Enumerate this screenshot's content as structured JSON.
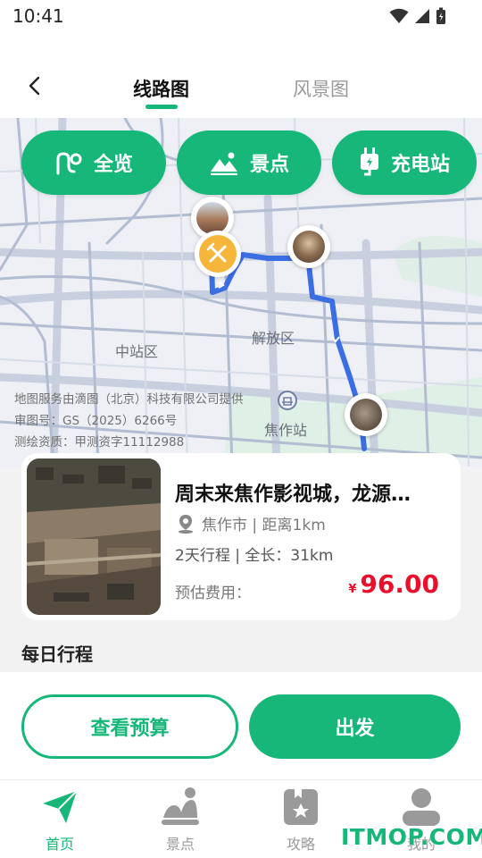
{
  "status_bar": {
    "time": "10:41",
    "tiny_code": "294a0701"
  },
  "header": {
    "tabs": [
      {
        "label": "线路图",
        "active": true
      },
      {
        "label": "风景图",
        "active": false
      }
    ]
  },
  "map": {
    "chips": [
      {
        "label": "全览",
        "icon": "route-icon"
      },
      {
        "label": "景点",
        "icon": "landscape-icon"
      },
      {
        "label": "充电站",
        "icon": "charging-plug-icon"
      }
    ],
    "labels": {
      "district_1": "中站区",
      "district_2": "解放区",
      "station": "焦作站"
    },
    "credit": {
      "line1": "地图服务由滴图（北京）科技有限公司提供",
      "line2": "审图号：GS（2025）6266号",
      "line3": "测绘资质：甲测资字11112988"
    }
  },
  "card": {
    "title": "周末来焦作影视城，龙源…",
    "location": "焦作市 | 距离1km",
    "trip": "2天行程 | 全长：31km",
    "cost_label": "预估费用：",
    "currency": "¥",
    "price": "96.00"
  },
  "section": {
    "daily_title": "每日行程"
  },
  "actions": {
    "budget": "查看预算",
    "go": "出发"
  },
  "nav": {
    "items": [
      {
        "label": "首页",
        "icon": "paper-plane-icon",
        "active": true
      },
      {
        "label": "景点",
        "icon": "mountain-icon",
        "active": false
      },
      {
        "label": "攻略",
        "icon": "guide-book-icon",
        "active": false
      },
      {
        "label": "我的",
        "icon": "profile-icon",
        "active": false
      }
    ]
  },
  "watermark": "ITMOP.COM",
  "colors": {
    "accent": "#17b77a",
    "price": "#e8102a",
    "route": "#3b6de3",
    "food_pin": "#f5b63b"
  }
}
